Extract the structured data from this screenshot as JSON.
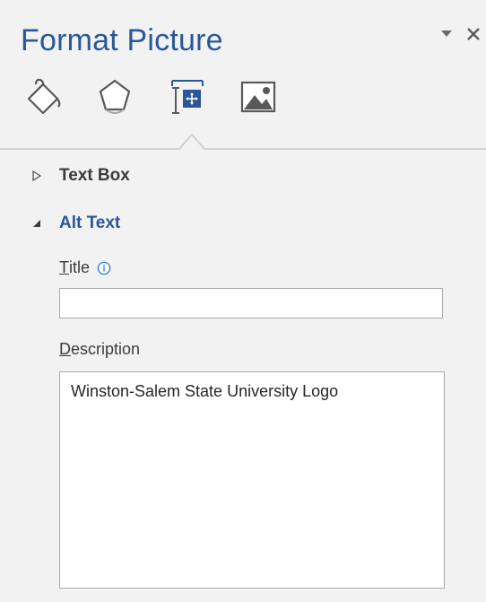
{
  "pane": {
    "title": "Format Picture",
    "accent_color": "#2b579a",
    "background_color": "#f2f2f2"
  },
  "controls": [
    {
      "name": "task-pane-options",
      "icon": "dropdown-triangle-icon"
    },
    {
      "name": "close-pane",
      "icon": "close-icon"
    }
  ],
  "tabs": [
    {
      "name": "fill-and-line",
      "icon": "paint-bucket-icon"
    },
    {
      "name": "effects",
      "icon": "pentagon-icon"
    },
    {
      "name": "layout-and-properties",
      "icon": "size-properties-icon",
      "selected": true
    },
    {
      "name": "picture",
      "icon": "picture-icon"
    }
  ],
  "sections": {
    "text_box": {
      "label": "Text Box",
      "expanded": false
    },
    "alt_text": {
      "label": "Alt Text",
      "expanded": true
    }
  },
  "fields": {
    "title": {
      "label_accel": "T",
      "label_rest": "itle",
      "value": ""
    },
    "description": {
      "label_accel": "D",
      "label_rest": "escription",
      "value": "Winston-Salem State University Logo"
    }
  }
}
